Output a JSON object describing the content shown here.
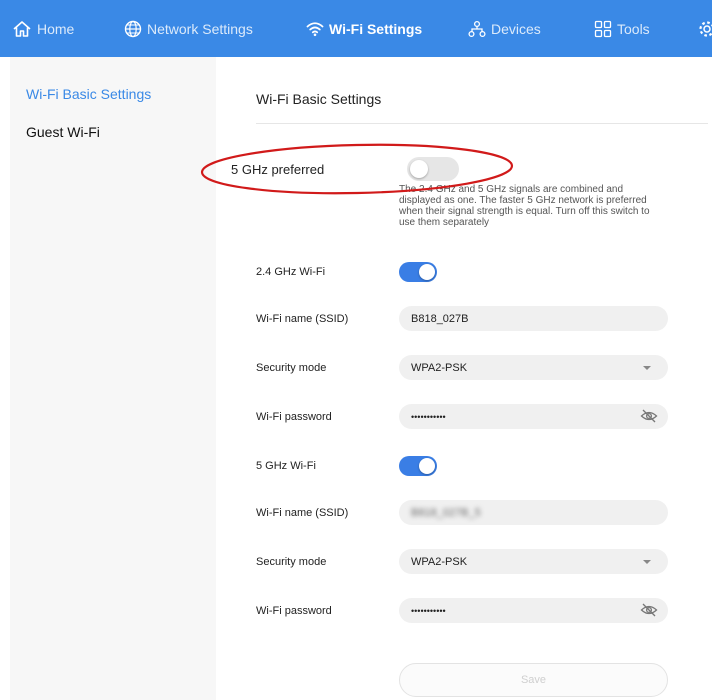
{
  "nav": {
    "home": "Home",
    "network": "Network Settings",
    "wifi": "Wi-Fi Settings",
    "devices": "Devices",
    "tools": "Tools"
  },
  "sidebar": {
    "items": [
      {
        "label": "Wi-Fi Basic Settings",
        "active": true
      },
      {
        "label": "Guest Wi-Fi",
        "active": false
      }
    ]
  },
  "main": {
    "title": "Wi-Fi Basic Settings",
    "preferred": {
      "label": "5 GHz preferred",
      "enabled": false,
      "description": "The 2.4 GHz and 5 GHz signals are combined and displayed as one. The faster 5 GHz network is preferred when their signal strength is equal. Turn off this switch to use them separately"
    },
    "band24": {
      "toggle_label": "2.4 GHz Wi-Fi",
      "enabled": true,
      "ssid_label": "Wi-Fi name (SSID)",
      "ssid_value": "B818_027B",
      "security_label": "Security mode",
      "security_value": "WPA2-PSK",
      "password_label": "Wi-Fi password",
      "password_value": "•••••••••••"
    },
    "band5": {
      "toggle_label": "5 GHz Wi-Fi",
      "enabled": true,
      "ssid_label": "Wi-Fi name (SSID)",
      "ssid_value": "B818_027B_5",
      "security_label": "Security mode",
      "security_value": "WPA2-PSK",
      "password_label": "Wi-Fi password",
      "password_value": "•••••••••••"
    },
    "save_label": "Save"
  },
  "colors": {
    "accent": "#3a89e6",
    "toggle_on": "#3a7ee5",
    "annotation": "#d11a1a"
  }
}
